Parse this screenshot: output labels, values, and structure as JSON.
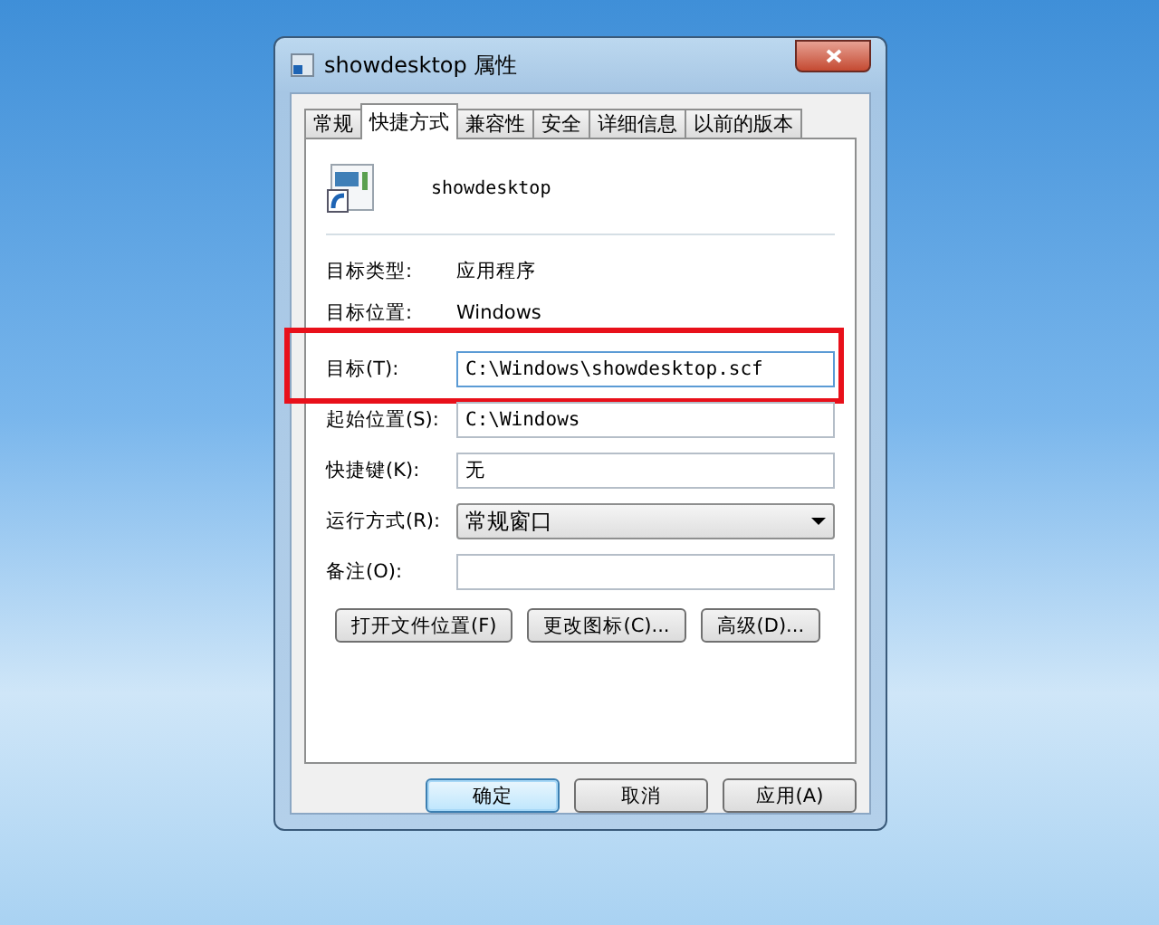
{
  "window": {
    "title": "showdesktop 属性"
  },
  "tabs": [
    {
      "label": "常规",
      "selected": false
    },
    {
      "label": "快捷方式",
      "selected": true
    },
    {
      "label": "兼容性",
      "selected": false
    },
    {
      "label": "安全",
      "selected": false
    },
    {
      "label": "详细信息",
      "selected": false
    },
    {
      "label": "以前的版本",
      "selected": false
    }
  ],
  "shortcut": {
    "name": "showdesktop"
  },
  "fields": [
    {
      "kind": "info",
      "label": "目标类型:",
      "value": "应用程序",
      "highlighted": false
    },
    {
      "kind": "info",
      "label": "目标位置:",
      "value": "Windows",
      "highlighted": false
    },
    {
      "kind": "text",
      "label": "目标(T):",
      "value": "C:\\Windows\\showdesktop.scf",
      "highlighted": true
    },
    {
      "kind": "text",
      "label": "起始位置(S):",
      "value": "C:\\Windows",
      "highlighted": false
    },
    {
      "kind": "text",
      "label": "快捷键(K):",
      "value": "无",
      "highlighted": false
    },
    {
      "kind": "combo",
      "label": "运行方式(R):",
      "value": "常规窗口",
      "highlighted": false
    },
    {
      "kind": "text",
      "label": "备注(O):",
      "highlighted": false
    }
  ],
  "actions": [
    "打开文件位置(F)",
    "更改图标(C)...",
    "高级(D)..."
  ],
  "buttons": [
    {
      "label": "确定",
      "default": true
    },
    {
      "label": "取消",
      "default": false
    },
    {
      "label": "应用(A)",
      "default": false
    }
  ]
}
